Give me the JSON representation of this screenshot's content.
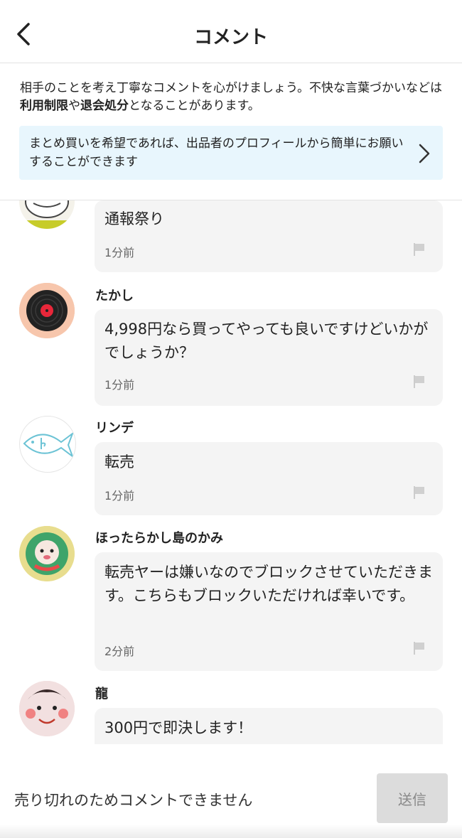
{
  "header": {
    "title": "コメント"
  },
  "notice": {
    "part1": "相手のことを考え丁寧なコメントを心がけましょう。不快な言葉づかいなどは",
    "bold1": "利用制限",
    "part2": "や",
    "bold2": "退会処分",
    "part3": "となることがあります。"
  },
  "banner": {
    "text": "まとめ買いを希望であれば、出品者のプロフィールから簡単にお願いすることができます"
  },
  "comments": [
    {
      "name": "",
      "body": "通報祭り",
      "time": "1分前"
    },
    {
      "name": "たかし",
      "body": "4,998円なら買ってやっても良いですけどいかがでしょうか？",
      "time": "1分前"
    },
    {
      "name": "リンデ",
      "body": "転売",
      "time": "1分前"
    },
    {
      "name": "ほったらかし島のかみ",
      "body": "転売ヤーは嫌いなのでブロックさせていただきます。こちらもブロックいただければ幸いです。",
      "time": "2分前"
    },
    {
      "name": "龍",
      "body": "300円で即決します！",
      "time": ""
    }
  ],
  "footer": {
    "status": "売り切れのためコメントできません",
    "send_label": "送信"
  }
}
